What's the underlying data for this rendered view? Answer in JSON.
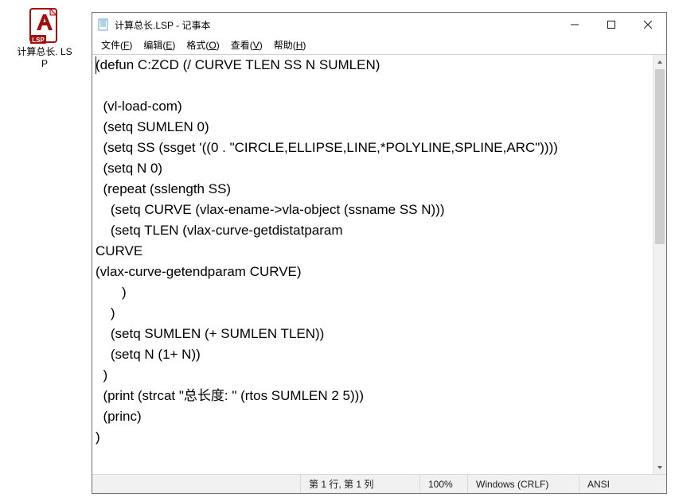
{
  "desktop_icon": {
    "label": "计算总长.\nLSP",
    "badge": "LSP"
  },
  "window": {
    "title": "计算总长.LSP - 记事本",
    "min_tooltip": "最小化",
    "max_tooltip": "最大化",
    "close_tooltip": "关闭"
  },
  "menu": {
    "file": {
      "pre": "文件(",
      "accel": "F",
      "post": ")"
    },
    "edit": {
      "pre": "编辑(",
      "accel": "E",
      "post": ")"
    },
    "format": {
      "pre": "格式(",
      "accel": "O",
      "post": ")"
    },
    "view": {
      "pre": "查看(",
      "accel": "V",
      "post": ")"
    },
    "help": {
      "pre": "帮助(",
      "accel": "H",
      "post": ")"
    }
  },
  "editor": {
    "content": "(defun C:ZCD (/ CURVE TLEN SS N SUMLEN)\n\n  (vl-load-com)\n  (setq SUMLEN 0)\n  (setq SS (ssget '((0 . \"CIRCLE,ELLIPSE,LINE,*POLYLINE,SPLINE,ARC\"))))\n  (setq N 0)\n  (repeat (sslength SS)\n    (setq CURVE (vlax-ename->vla-object (ssname SS N)))\n    (setq TLEN (vlax-curve-getdistatparam\nCURVE\n(vlax-curve-getendparam CURVE)\n       )\n    )\n    (setq SUMLEN (+ SUMLEN TLEN))\n    (setq N (1+ N))\n  )\n  (print (strcat \"总长度: \" (rtos SUMLEN 2 5)))\n  (princ)\n)"
  },
  "statusbar": {
    "position": "第 1 行, 第 1 列",
    "zoom": "100%",
    "eol": "Windows (CRLF)",
    "encoding": "ANSI"
  }
}
